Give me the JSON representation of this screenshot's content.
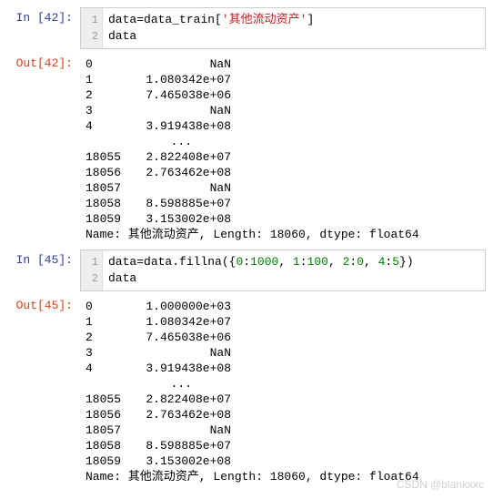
{
  "cell1": {
    "prompt": "In  [42]:",
    "gutter": [
      "1",
      "2"
    ],
    "code": {
      "var1": "data",
      "eq": "=",
      "var2": "data_train",
      "br1": "[",
      "str": "'其他流动资产'",
      "br2": "]",
      "line2": "data"
    }
  },
  "out1": {
    "prompt": "Out[42]:",
    "rows": [
      {
        "idx": "0",
        "val": "NaN"
      },
      {
        "idx": "1",
        "val": "1.080342e+07"
      },
      {
        "idx": "2",
        "val": "7.465038e+06"
      },
      {
        "idx": "3",
        "val": "NaN"
      },
      {
        "idx": "4",
        "val": "3.919438e+08"
      }
    ],
    "ellipsis": "            ...     ",
    "rows2": [
      {
        "idx": "18055",
        "val": "2.822408e+07"
      },
      {
        "idx": "18056",
        "val": "2.763462e+08"
      },
      {
        "idx": "18057",
        "val": "NaN"
      },
      {
        "idx": "18058",
        "val": "8.598885e+07"
      },
      {
        "idx": "18059",
        "val": "3.153002e+08"
      }
    ],
    "meta": "Name: 其他流动资产, Length: 18060, dtype: float64"
  },
  "cell2": {
    "prompt": "In  [45]:",
    "gutter": [
      "1",
      "2"
    ],
    "code": {
      "var1": "data",
      "eq": "=",
      "call": "data.fillna",
      "p1": "({",
      "k0": "0",
      "c0": ":",
      "v0": "1000",
      "s0": ", ",
      "k1": "1",
      "c1": ":",
      "v1": "100",
      "s1": ", ",
      "k2": "2",
      "c2": ":",
      "v2": "0",
      "s2": ", ",
      "k3": "4",
      "c3": ":",
      "v3": "5",
      "p2": "})",
      "line2": "data"
    }
  },
  "out2": {
    "prompt": "Out[45]:",
    "rows": [
      {
        "idx": "0",
        "val": "1.000000e+03"
      },
      {
        "idx": "1",
        "val": "1.080342e+07"
      },
      {
        "idx": "2",
        "val": "7.465038e+06"
      },
      {
        "idx": "3",
        "val": "NaN"
      },
      {
        "idx": "4",
        "val": "3.919438e+08"
      }
    ],
    "ellipsis": "            ...     ",
    "rows2": [
      {
        "idx": "18055",
        "val": "2.822408e+07"
      },
      {
        "idx": "18056",
        "val": "2.763462e+08"
      },
      {
        "idx": "18057",
        "val": "NaN"
      },
      {
        "idx": "18058",
        "val": "8.598885e+07"
      },
      {
        "idx": "18059",
        "val": "3.153002e+08"
      }
    ],
    "meta": "Name: 其他流动资产, Length: 18060, dtype: float64"
  },
  "watermark": "CSDN @blankxxc"
}
